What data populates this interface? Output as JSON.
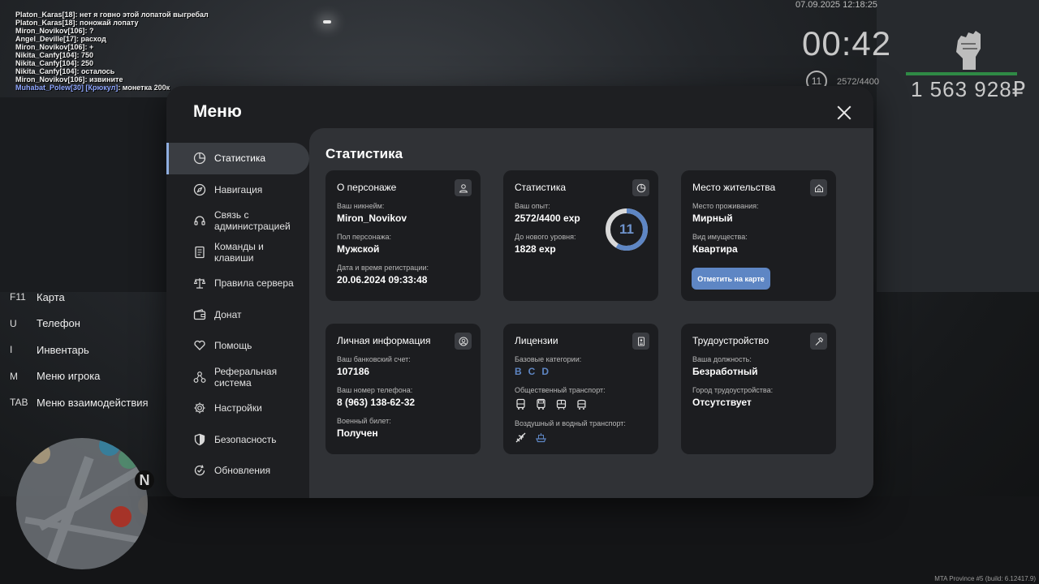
{
  "chat": [
    {
      "text": "Platon_Karas[18]: нет я говно этой лопатой выгребал"
    },
    {
      "text": "Platon_Karas[18]: поножай лопату"
    },
    {
      "text": "Miron_Novikov[106]: ?"
    },
    {
      "text": "Angel_Deville[17]: расход"
    },
    {
      "text": "Miron_Novikov[106]: +"
    },
    {
      "text": "Nikita_Canfy[104]: 750"
    },
    {
      "text": "Nikita_Canfy[104]: 250"
    },
    {
      "text": "Nikita_Canfy[104]: осталось"
    },
    {
      "text": "Miron_Novikov[106]: извините"
    }
  ],
  "chat_highlight": {
    "name": "Muhabat_Polew[30]",
    "tag": "[Крюкул]",
    "text": ": монетка 200к"
  },
  "hud": {
    "date": "07.09.2025 12:18:25",
    "time": "00:42",
    "level": "11",
    "exp": "2572/4400",
    "money": "1 563 928₽",
    "bar_color": "#2f8a45"
  },
  "hotkeys": [
    {
      "key": "F11",
      "action": "Карта"
    },
    {
      "key": "U",
      "action": "Телефон"
    },
    {
      "key": "I",
      "action": "Инвентарь"
    },
    {
      "key": "M",
      "action": "Меню игрока"
    },
    {
      "key": "TAB",
      "action": "Меню взаимодействия"
    }
  ],
  "minimap": {
    "north": "N"
  },
  "build": "MTA Province #5 (build: 6.12417.9)",
  "menu": {
    "title": "Меню",
    "nav": [
      {
        "label": "Статистика",
        "icon": "pie-chart-icon",
        "active": true
      },
      {
        "label": "Навигация",
        "icon": "compass-icon"
      },
      {
        "label": "Связь с администрацией",
        "icon": "headset-icon"
      },
      {
        "label": "Команды и клавиши",
        "icon": "document-icon"
      },
      {
        "label": "Правила сервера",
        "icon": "scales-icon"
      },
      {
        "label": "Донат",
        "icon": "wallet-icon"
      },
      {
        "label": "Помощь",
        "icon": "heart-hand-icon"
      },
      {
        "label": "Реферальная система",
        "icon": "referral-icon"
      },
      {
        "label": "Настройки",
        "icon": "gear-icon"
      },
      {
        "label": "Безопасность",
        "icon": "shield-icon"
      },
      {
        "label": "Обновления",
        "icon": "refresh-check-icon"
      }
    ],
    "content_title": "Статистика",
    "cards": {
      "character": {
        "title": "О персонаже",
        "nickname_label": "Ваш никнейм:",
        "nickname": "Miron_Novikov",
        "gender_label": "Пол персонажа:",
        "gender": "Мужской",
        "reg_label": "Дата и время регистрации:",
        "reg": "20.06.2024 09:33:48"
      },
      "stats": {
        "title": "Статистика",
        "exp_label": "Ваш опыт:",
        "exp": "2572/4400 exp",
        "next_label": "До нового уровня:",
        "next": "1828 exp",
        "level": "11",
        "progress": 0.5845,
        "accent": "#5e86c4"
      },
      "residence": {
        "title": "Место жительства",
        "place_label": "Место проживания:",
        "place": "Мирный",
        "property_label": "Вид имущества:",
        "property": "Квартира",
        "button": "Отметить на карте"
      },
      "personal": {
        "title": "Личная информация",
        "bank_label": "Ваш банковский счет:",
        "bank": "107186",
        "phone_label": "Ваш номер телефона:",
        "phone": "8 (963) 138-62-32",
        "military_label": "Военный билет:",
        "military": "Получен"
      },
      "licenses": {
        "title": "Лицензии",
        "base_label": "Базовые категории:",
        "categories": [
          "B",
          "C",
          "D"
        ],
        "public_label": "Общественный транспорт:",
        "public_icons": [
          "bus-icon",
          "bus-icon",
          "tram-icon",
          "trolleybus-icon"
        ],
        "air_label": "Воздушный и водный транспорт:",
        "air_icons": [
          "plane-icon",
          "ship-icon"
        ]
      },
      "job": {
        "title": "Трудоустройство",
        "position_label": "Ваша должность:",
        "position": "Безработный",
        "city_label": "Город трудоустройства:",
        "city": "Отсутствует"
      }
    }
  }
}
